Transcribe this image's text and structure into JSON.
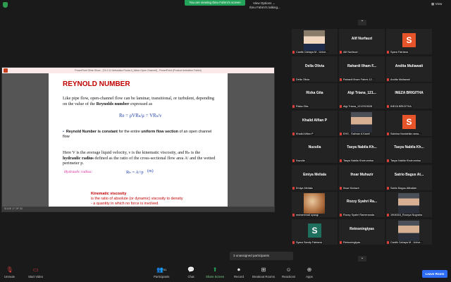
{
  "top_banner": "You are viewing Ibnu Fahmi's screen",
  "view_options": "View Options",
  "view_label": "View",
  "talking": "Ibnu Fahmi's talking...",
  "share": {
    "window_title": "PowerPoint Slide Show - [TA 2.11 Mekanika Fluida II_Aliran Open Channel] - PowerPoint (Product Activation Failed)",
    "status": "SLIDE 17 OF 33",
    "slide": {
      "title": "REYNOLD NUMBER",
      "p1": "Like pipe flow, open-channel flow can be laminar, transitional, or turbulent, depending on the value of the",
      "p1_bold": "Reynolds number",
      "p1_end": "expressed as",
      "re_formula": "Re = ρVRₕ/μ = VRₕ/ν",
      "bullet_bold1": "Reynold Number is constant",
      "bullet_mid": "for the entire",
      "bullet_bold2": "uniform flow section",
      "bullet_end": "of an open channel flow",
      "p2a": "Here V is the average liquid velocity, ν is the kinematic viscosity, and Rₕ is the",
      "p2_bold": "hydraulic radius",
      "p2b": "defined as the ratio of the cross-sectional flow area Aᶜ and the wetted perimeter p.",
      "hr_label": "Hydraulic radius:",
      "hr_formula": "Rₕ = Aᶜ/p",
      "hr_unit": "(m)",
      "kv_title": "Kinematic viscosity",
      "kv_line1": "is the ratio of absolute (or dynamic) viscosity to density",
      "kv_line2": "- a quantity in which no force is involved."
    }
  },
  "gallery": {
    "tiles": [
      {
        "name": "",
        "label": "Cantik Cahaya M - Unive...",
        "avatar": "photo-female-1",
        "muted": true
      },
      {
        "name": "Alif Nurfauzi",
        "label": "Alif Nurfauzi",
        "muted": true
      },
      {
        "name": "",
        "label": "Syara Fatriana",
        "avatar_letter": "S",
        "avatar_color": "#e8542a",
        "muted": true
      },
      {
        "name": "Della Olivia",
        "label": "Della Olivia",
        "muted": true
      },
      {
        "name": "Rahardi Ilham F...",
        "label": "Rahardi Ilham Fahmi-12...",
        "muted": true
      },
      {
        "name": "Andita Muliawati",
        "label": "Andita Muliawati",
        "muted": true
      },
      {
        "name": "Rizka Gita",
        "label": "Rizka Gita",
        "muted": true
      },
      {
        "name": "Algi Triana_121...",
        "label": "Algi Triana_1212915028",
        "muted": true
      },
      {
        "name": "INEZA BRIGITHA",
        "label": "INEZA BRIGITHA",
        "muted": true
      },
      {
        "name": "Khalid Alfian P",
        "label": "Khalid Alfian P",
        "muted": true
      },
      {
        "name": "",
        "label": "EHS - Salman A Kamil",
        "avatar": "photo-male-1",
        "muted": true
      },
      {
        "name": "",
        "label": "Sabrina Nurdahlia rama...",
        "avatar_letter": "S",
        "avatar_color": "#e8542a",
        "muted": true
      },
      {
        "name": "Nuzulia",
        "label": "Nuzulia",
        "muted": true
      },
      {
        "name": "Tasya Nabila Kh...",
        "label": "Tasya Nabila Khoirunnisa",
        "muted": true
      },
      {
        "name": "Tasya Nabila Kh...",
        "label": "Tasya Nabila Khoirunnisa",
        "muted": true
      },
      {
        "name": "Emiya Meliala",
        "label": "Emiya Meliala",
        "muted": true
      },
      {
        "name": "Ihsar Muhazir",
        "label": "Ihsar Muhazir",
        "muted": true
      },
      {
        "name": "Satrio Bagus At...",
        "label": "Satrio Bagus Atthallah",
        "muted": true
      },
      {
        "name": "",
        "label": "muhammad syaugi",
        "avatar": "photo-food",
        "muted": true
      },
      {
        "name": "Rozzy Syahri Ra...",
        "label": "Rozzy Syahri Ramenanda",
        "muted": true
      },
      {
        "name": "",
        "label": "1904518_Rozzya Nugraha",
        "avatar": "photo-male-2",
        "muted": true
      },
      {
        "name": "",
        "label": "Syara Sandy Fatriana",
        "avatar_letter": "S",
        "avatar_color": "#1f6f5f",
        "muted": true
      },
      {
        "name": "Retnoningtyas",
        "label": "Retnoningtyas",
        "muted": true
      },
      {
        "name": "",
        "label": "Cantik Cahaya M - Unive...",
        "avatar": "photo-male-3",
        "muted": true
      }
    ]
  },
  "unassigned": "3 unassigned participants",
  "toolbar": {
    "unmute": "Unmute",
    "start_video": "Start Video",
    "participants": "Participants",
    "participants_count": "51",
    "chat": "Chat",
    "share_screen": "Share Screen",
    "record": "Record",
    "breakout_rooms": "Breakout Rooms",
    "reactions": "Reactions",
    "apps": "Apps",
    "leave": "Leave Room"
  }
}
